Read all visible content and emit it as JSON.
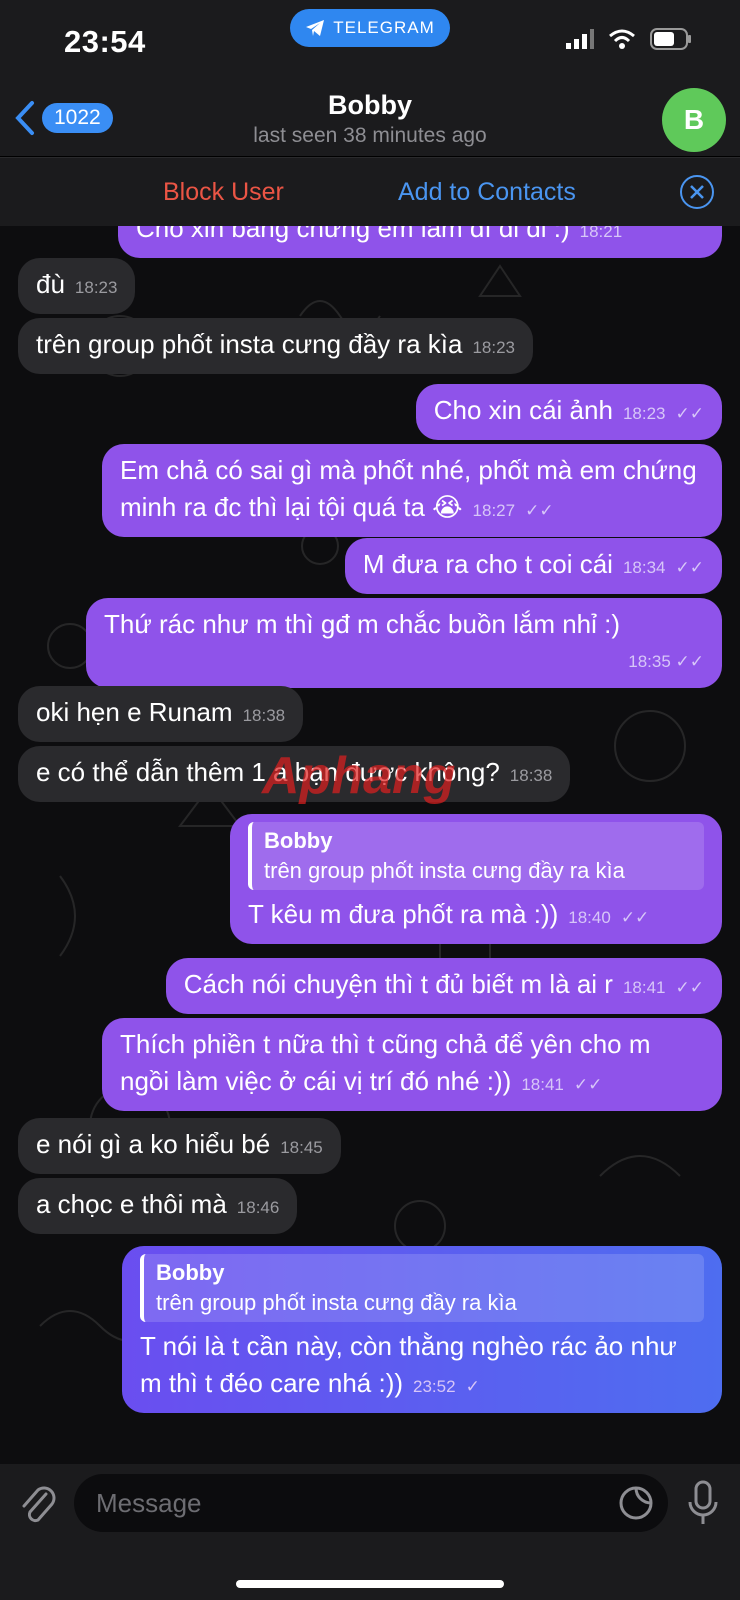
{
  "status_bar": {
    "time": "23:54",
    "app_pill": "TELEGRAM"
  },
  "nav": {
    "back_count": "1022",
    "title": "Bobby",
    "subtitle": "last seen 38 minutes ago",
    "avatar_letter": "B"
  },
  "actions": {
    "block": "Block User",
    "add": "Add to Contacts"
  },
  "messages": [
    {
      "text": "Cho xin bằng chứng em làm dì đi đi :)",
      "time": "18:21"
    },
    {
      "text": "đù",
      "time": "18:23"
    },
    {
      "text": "trên group phốt insta cưng đầy ra kìa",
      "time": "18:23"
    },
    {
      "text": "Cho xin cái ảnh",
      "time": "18:23"
    },
    {
      "text": "Em chả có sai gì mà phốt nhé, phốt mà em chứng minh ra đc thì lại tội quá ta 😭",
      "time": "18:27"
    },
    {
      "text": "M đưa ra cho t coi cái",
      "time": "18:34"
    },
    {
      "text": "Thứ rác như m thì gđ m chắc buồn lắm nhỉ :)",
      "time": "18:35"
    },
    {
      "text": "oki hẹn e Runam",
      "time": "18:38"
    },
    {
      "text": "e có thể dẫn thêm 1 a bạn được không?",
      "time": "18:38"
    },
    {
      "quote_name": "Bobby",
      "quote_text": "trên group phốt insta cưng đầy ra kìa",
      "text": "T kêu m đưa phốt ra mà :))",
      "time": "18:40"
    },
    {
      "text": "Cách nói chuyện thì t đủ biết m là ai r",
      "time": "18:41"
    },
    {
      "text": "Thích phiền t nữa thì t cũng chả để yên cho m ngồi làm việc ở cái vị trí đó nhé :))",
      "time": "18:41"
    },
    {
      "text": "e nói gì a ko hiểu bé",
      "time": "18:45"
    },
    {
      "text": "a chọc e thôi mà",
      "time": "18:46"
    },
    {
      "quote_name": "Bobby",
      "quote_text": "trên group phốt insta cưng đầy ra kìa",
      "text": "T nói là t cần này, còn thằng nghèo rác ảo như m thì t đéo care nhá :))",
      "time": "23:52"
    }
  ],
  "watermark": "Aphang",
  "input": {
    "placeholder": "Message"
  }
}
